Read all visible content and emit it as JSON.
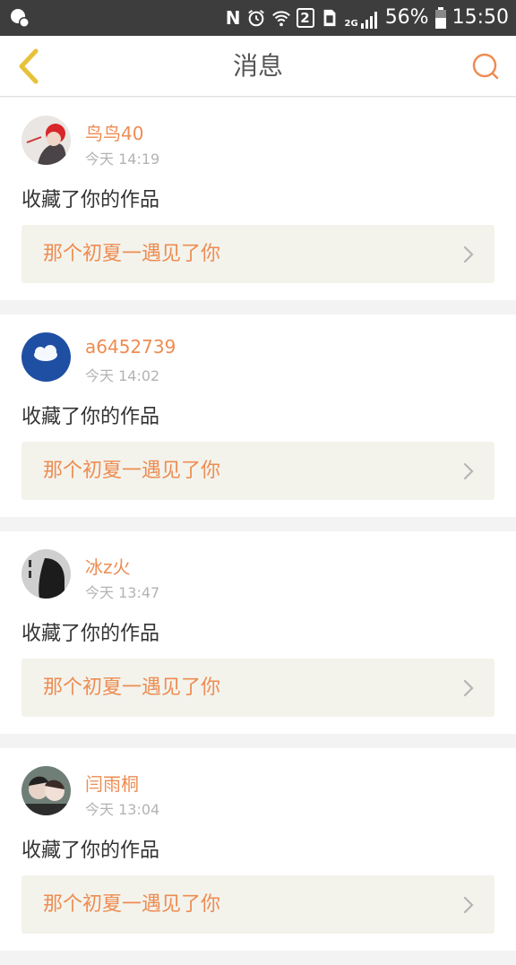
{
  "status_bar": {
    "sim_slot": "2",
    "network": "2G",
    "battery": "56%",
    "time": "15:50"
  },
  "header": {
    "title": "消息",
    "back_icon": "chevron-left-icon",
    "search_icon": "search-icon",
    "accent_color": "#ee8c52"
  },
  "messages": [
    {
      "username": "鸟鸟40",
      "time": "今天 14:19",
      "action": "收藏了你的作品",
      "work_title": "那个初夏一遇见了你"
    },
    {
      "username": "a6452739",
      "time": "今天 14:02",
      "action": "收藏了你的作品",
      "work_title": "那个初夏一遇见了你"
    },
    {
      "username": "冰z火",
      "time": "今天 13:47",
      "action": "收藏了你的作品",
      "work_title": "那个初夏一遇见了你"
    },
    {
      "username": "闫雨桐",
      "time": "今天 13:04",
      "action": "收藏了你的作品",
      "work_title": "那个初夏一遇见了你"
    }
  ]
}
